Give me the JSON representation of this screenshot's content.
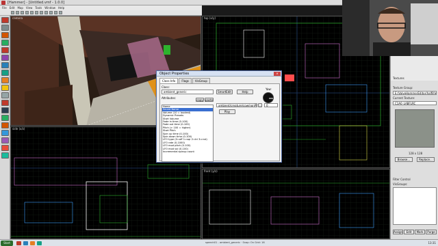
{
  "window": {
    "title": "[Hammer] - [Untitled.vmf - 1.0.0]"
  },
  "menu": [
    "File",
    "Edit",
    "Map",
    "View",
    "Tools",
    "Window",
    "Help"
  ],
  "viewports": {
    "camera": "camera",
    "top": "top (x/y)",
    "side": "side (x/z)",
    "front": "front (y/z)"
  },
  "dialog": {
    "title": "Object Properties",
    "tabs": [
      "Class Info",
      "Flags",
      "VisGroup"
    ],
    "class_label": "Class:",
    "class_value": "ambient_generic",
    "smartedit_label": "SmartEdit",
    "help_label": "Help",
    "angle_label": "Yaw:",
    "attributes_label": "Attributes:",
    "copy_label": "copy",
    "paste_label": "paste",
    "value_field": "ambient/creature/cow/nonPlayerGrunts/shortGrunt",
    "angle_value": "0",
    "play_label": "Play",
    "attributes": [
      "Name",
      "Sound Name",
      "Volume (10 = loudest)",
      "Dynamic Presets",
      "Start Volume",
      "Fade in time (0-100)",
      "Fade out time (0-100)",
      "Pitch (> 100 = higher)",
      "Start Pitch",
      "Spin up time (0-100)",
      "Spin down time (0-100)",
      "LFO type (0=off 1=sqr 2=tri 3=rnd)",
      "LFO rate (0-1000)",
      "LFO mod pitch (0-100)",
      "LFO mod vol (0-100)",
      "Incremental spinup count"
    ],
    "selected_index": 1
  },
  "right_panel": {
    "textures_label": "Textures",
    "texture_group_label": "Texture Group:",
    "texture_group_value": "E:/ValveHammerEditor/halflife.wad",
    "current_texture_label": "Current Texture:",
    "current_texture_value": "C1A0_LABFLRC",
    "size_label": "128 x 128",
    "browse_label": "Browse...",
    "replace_label": "Replace...",
    "filter_label": "Filter Control",
    "visgroups_label": "VisGroups:",
    "assign_label": "Assign",
    "edit_label": "Edit",
    "mark_label": "Mark",
    "purge_label": "Purge"
  },
  "taskbar": {
    "start": "Start",
    "status": "speech01 - ambient_generic",
    "grid": "Snap: On Grid: 16",
    "clock": "13:31"
  }
}
